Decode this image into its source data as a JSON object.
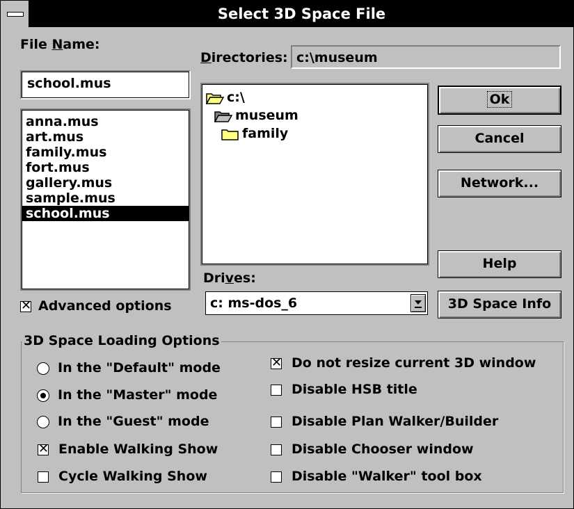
{
  "window": {
    "title": "Select 3D Space File"
  },
  "file_name": {
    "label_prefix": "File ",
    "label_underlined": "N",
    "label_suffix": "ame:",
    "value": "school.mus"
  },
  "files": [
    {
      "name": "anna.mus",
      "selected": false
    },
    {
      "name": "art.mus",
      "selected": false
    },
    {
      "name": "family.mus",
      "selected": false
    },
    {
      "name": "fort.mus",
      "selected": false
    },
    {
      "name": "gallery.mus",
      "selected": false
    },
    {
      "name": "sample.mus",
      "selected": false
    },
    {
      "name": "school.mus",
      "selected": true
    }
  ],
  "directories": {
    "label_underlined": "D",
    "label_suffix": "irectories:",
    "current": "c:\\museum",
    "tree": [
      {
        "name": "c:\\",
        "icon": "open-folder-icon"
      },
      {
        "name": "museum",
        "icon": "open-folder-icon"
      },
      {
        "name": "family",
        "icon": "closed-folder-icon"
      }
    ]
  },
  "drives": {
    "label_prefix": "Dri",
    "label_underlined": "v",
    "label_suffix": "es:",
    "value": "c: ms-dos_6"
  },
  "buttons": {
    "ok": "Ok",
    "cancel": "Cancel",
    "network": "Network...",
    "help": "Help",
    "space_info": "3D Space Info"
  },
  "advanced_options": {
    "label": "Advanced options",
    "checked": true
  },
  "loading_options": {
    "title": "3D Space Loading Options",
    "modes": [
      {
        "label": "In the \"Default\" mode",
        "selected": false
      },
      {
        "label": "In the \"Master\" mode",
        "selected": true
      },
      {
        "label": "In the \"Guest\" mode",
        "selected": false
      }
    ],
    "left_checks": [
      {
        "label": "Enable Walking Show",
        "checked": true
      },
      {
        "label": "Cycle Walking Show",
        "checked": false
      }
    ],
    "right_checks": [
      {
        "label": "Do not resize current 3D window",
        "checked": true
      },
      {
        "label": "Disable HSB title",
        "checked": false
      },
      {
        "label": "Disable Plan Walker/Builder",
        "checked": false
      },
      {
        "label": "Disable Chooser window",
        "checked": false
      },
      {
        "label": "Disable \"Walker\" tool box",
        "checked": false
      }
    ]
  }
}
